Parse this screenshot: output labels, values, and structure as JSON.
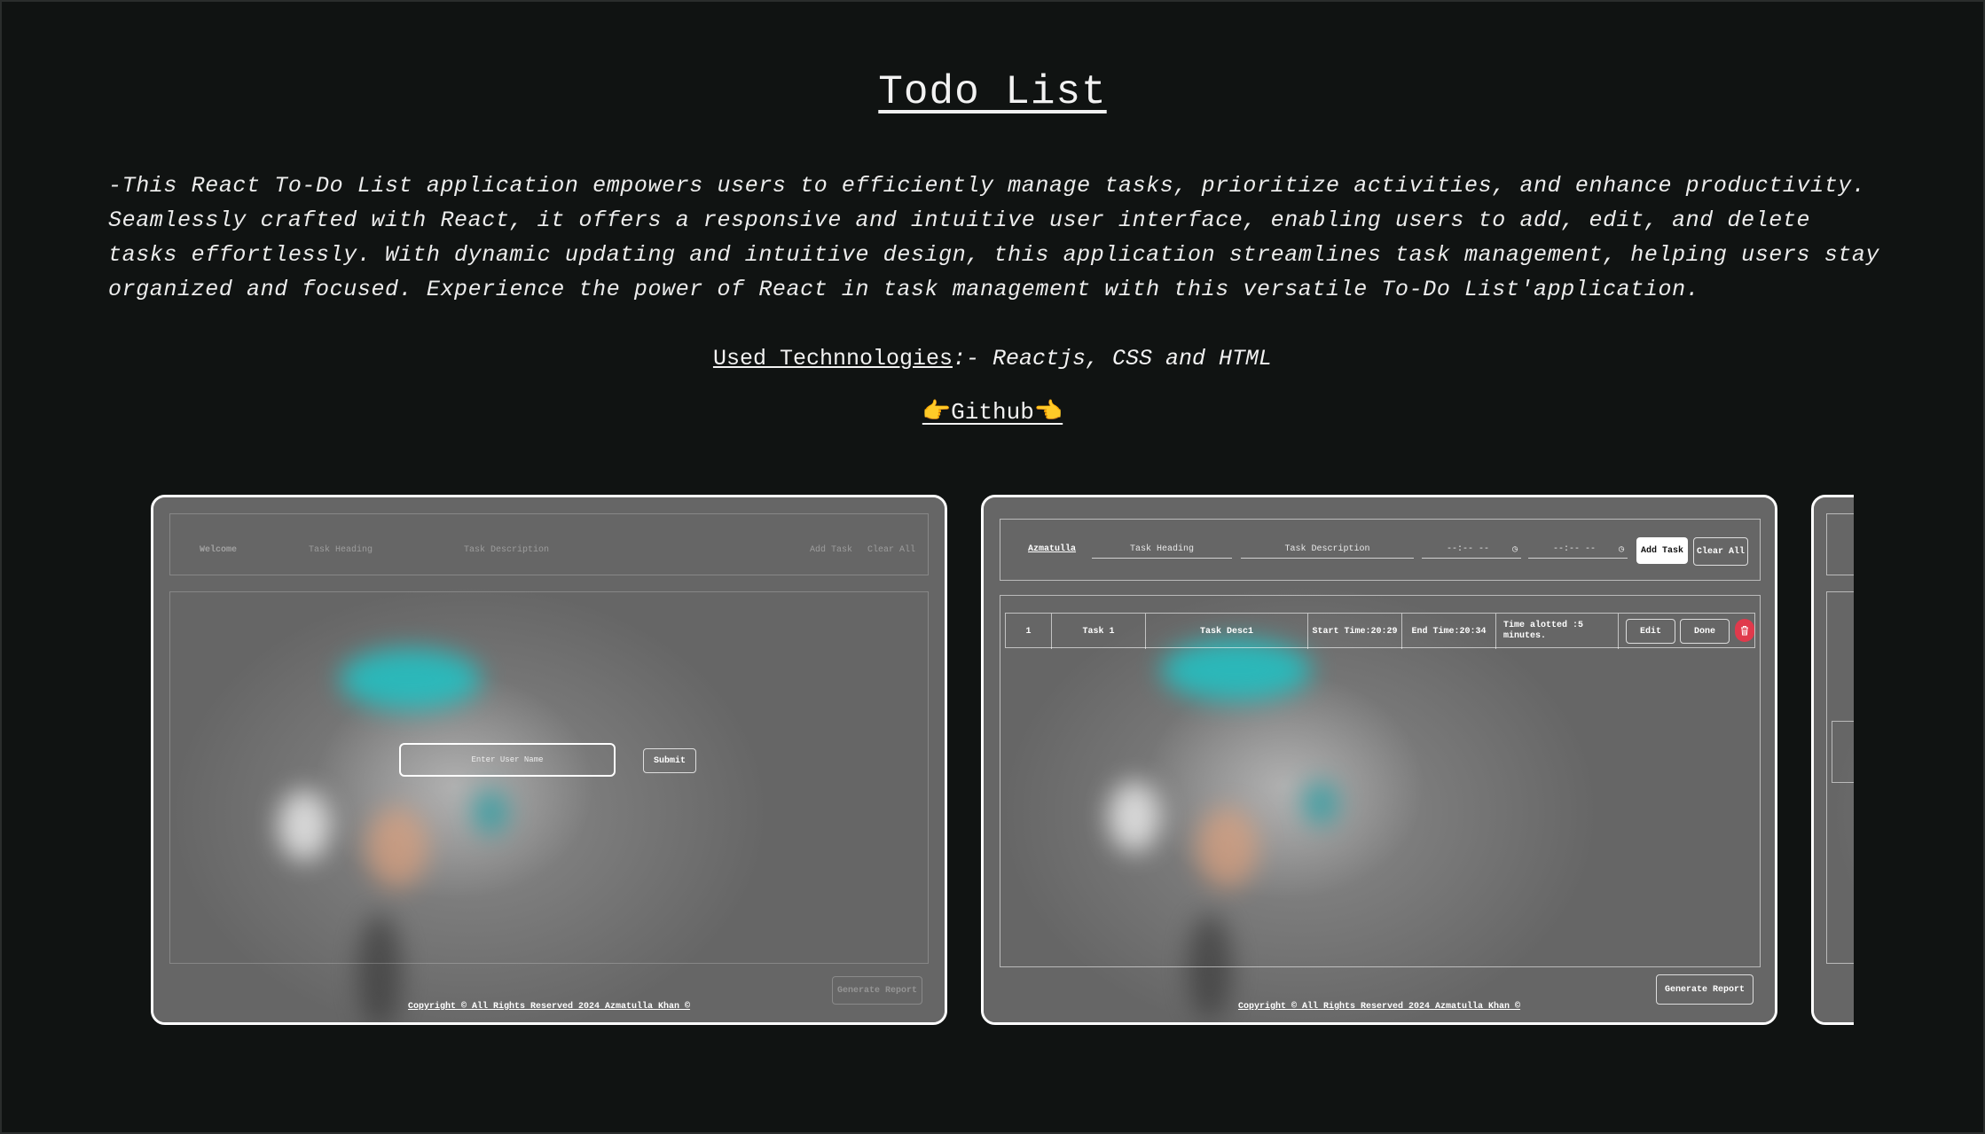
{
  "project": {
    "title": "Todo List",
    "description": "-This React To-Do List application empowers users to efficiently manage tasks, prioritize activities, and enhance productivity. Seamlessly crafted with React, it offers a responsive and intuitive user interface, enabling users to add, edit, and delete tasks effortlessly. With dynamic updating and intuitive design, this application streamlines task management, helping users stay organized and focused. Experience the power of React in task management with this versatile To-Do List'application.",
    "tech_label": "Used Technnologies",
    "tech_list": ":- Reactjs, CSS and HTML",
    "github_label": "👉Github👈"
  },
  "slide1": {
    "user_placeholder": "Enter User Name",
    "submit_label": "Submit",
    "nav_welcome": "Welcome",
    "nav_heading": "Task Heading",
    "nav_desc": "Task Description",
    "nav_add": "Add Task",
    "nav_clear": "Clear All",
    "report_label": "Generate Report",
    "copyright": "Copyright © All Rights Reserved 2024 Azmatulla Khan ©"
  },
  "slide2": {
    "username": "Azmatulla",
    "heading_placeholder": "Task Heading",
    "desc_placeholder": "Task Description",
    "time_placeholder": "--:-- --",
    "add_task_label": "Add Task",
    "clear_all_label": "Clear All",
    "row": {
      "index": "1",
      "task": "Task 1",
      "desc": "Task Desc1",
      "start": "Start Time:20:29",
      "end": "End Time:20:34",
      "allotted": "Time alotted :5 minutes.",
      "edit_label": "Edit",
      "done_label": "Done"
    },
    "report_label": "Generate Report",
    "copyright": "Copyright © All Rights Reserved 2024 Azmatulla Khan ©"
  },
  "colors": {
    "background": "#101312",
    "delete": "#e03a4c",
    "accent_cyan": "#19c7c9"
  },
  "icons": [
    "clock-icon",
    "trash-icon",
    "pointing-right-emoji",
    "pointing-left-emoji"
  ]
}
